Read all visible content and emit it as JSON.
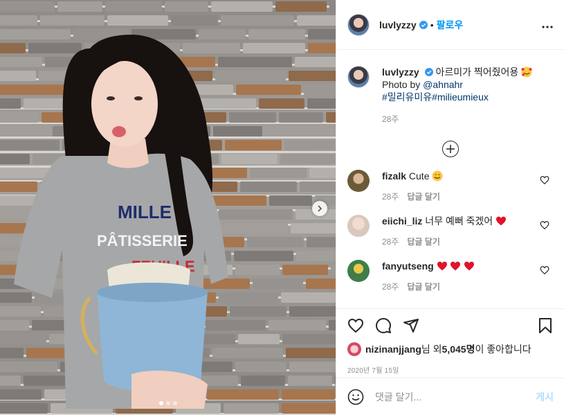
{
  "post": {
    "username": "luvlyzzy",
    "follow_label": "팔로우",
    "separator": "•",
    "caption_text": "아르미가 찍어줬어용",
    "caption_photo_by": "Photo by ",
    "caption_mention": "@ahnahr",
    "caption_tags": "#밀리유미유#milieumieux",
    "caption_time": "28주"
  },
  "comments": [
    {
      "username": "fizalk",
      "text": "Cute",
      "time": "28주",
      "reply": "답글 달기",
      "avatar_color": "#6b5a3a"
    },
    {
      "username": "eiichi_liz",
      "text": "너무 예뻐 죽겠어",
      "time": "28주",
      "reply": "답글 달기",
      "avatar_color": "#d9c8bb"
    },
    {
      "username": "fanyutseng",
      "text": "",
      "time": "28주",
      "reply": "답글 달기",
      "avatar_color": "#3f7d4a"
    }
  ],
  "likes": {
    "liker": "nizinanjjang",
    "text_mid": "님 외 ",
    "count": "5,045명",
    "text_end": "이 좋아합니다"
  },
  "date": "2020년 7월 15일",
  "comment_box": {
    "placeholder": "댓글 달기...",
    "post_label": "게시"
  },
  "colors": {
    "link": "#00376b",
    "follow_blue": "#0095f6",
    "post_disabled": "#b2dffc",
    "heart_red": "#ed4956"
  },
  "carousel": {
    "current": 1,
    "total": 3
  }
}
